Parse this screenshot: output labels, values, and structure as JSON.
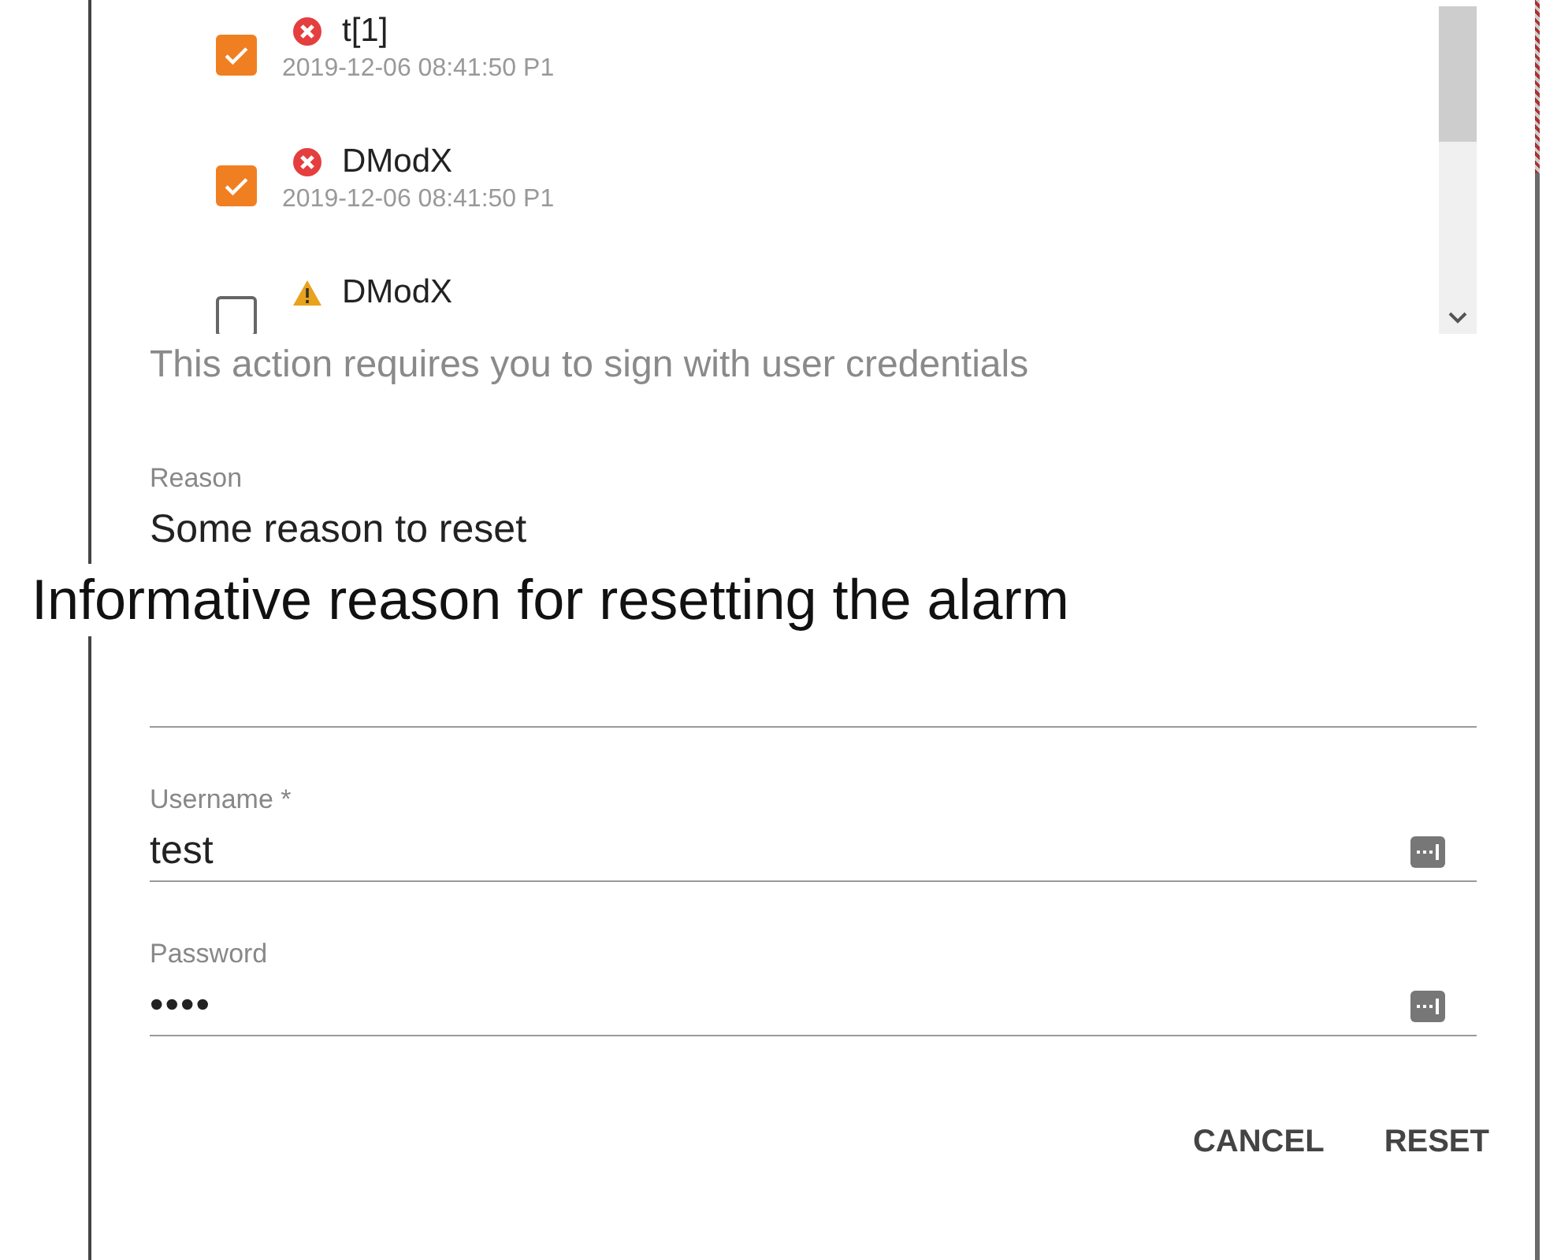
{
  "alarms": [
    {
      "checked": true,
      "kind": "error",
      "name": "t[1]",
      "timestamp": "2019-12-06 08:41:50 P1"
    },
    {
      "checked": true,
      "kind": "error",
      "name": "DModX",
      "timestamp": "2019-12-06 08:41:50 P1"
    },
    {
      "checked": false,
      "kind": "warning",
      "name": "DModX"
    }
  ],
  "notice": "This action requires you to sign with user credentials",
  "reason": {
    "label": "Reason",
    "value": "Some reason to reset",
    "tooltip": "Informative reason for resetting the alarm"
  },
  "username": {
    "label": "Username *",
    "value": "test"
  },
  "password": {
    "label": "Password",
    "value": "••••"
  },
  "buttons": [
    "CANCEL",
    "RESET"
  ]
}
